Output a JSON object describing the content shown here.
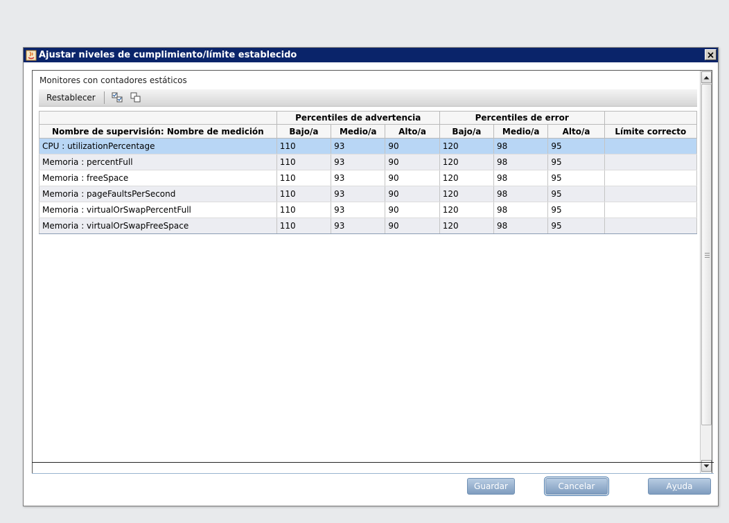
{
  "window": {
    "title": "Ajustar niveles de cumplimiento/límite establecido",
    "close_label": "✕"
  },
  "panel": {
    "section_label": "Monitores con contadores estáticos",
    "toolbar": {
      "reset_label": "Restablecer",
      "icons": [
        "select-all-icon",
        "copy-icon"
      ]
    }
  },
  "table": {
    "group_headers": {
      "warning": "Percentiles de advertencia",
      "error": "Percentiles de error"
    },
    "columns": [
      "Nombre de supervisión: Nombre de medición",
      "Bajo/a",
      "Medio/a",
      "Alto/a",
      "Bajo/a",
      "Medio/a",
      "Alto/a",
      "Límite correcto"
    ],
    "rows": [
      [
        "CPU : utilizationPercentage",
        "110",
        "93",
        "90",
        "120",
        "98",
        "95",
        ""
      ],
      [
        "Memoria : percentFull",
        "110",
        "93",
        "90",
        "120",
        "98",
        "95",
        ""
      ],
      [
        "Memoria : freeSpace",
        "110",
        "93",
        "90",
        "120",
        "98",
        "95",
        ""
      ],
      [
        "Memoria : pageFaultsPerSecond",
        "110",
        "93",
        "90",
        "120",
        "98",
        "95",
        ""
      ],
      [
        "Memoria : virtualOrSwapPercentFull",
        "110",
        "93",
        "90",
        "120",
        "98",
        "95",
        ""
      ],
      [
        "Memoria : virtualOrSwapFreeSpace",
        "110",
        "93",
        "90",
        "120",
        "98",
        "95",
        ""
      ]
    ],
    "selected_row": 0
  },
  "buttons": {
    "save": "Guardar",
    "cancel": "Cancelar",
    "help_prefix": "A",
    "help_mnemonic": "y",
    "help_suffix": "uda"
  },
  "colors": {
    "titlebar": "#0a246a",
    "selected_row": "#b8d6f5",
    "button": "#8fa9c8"
  }
}
